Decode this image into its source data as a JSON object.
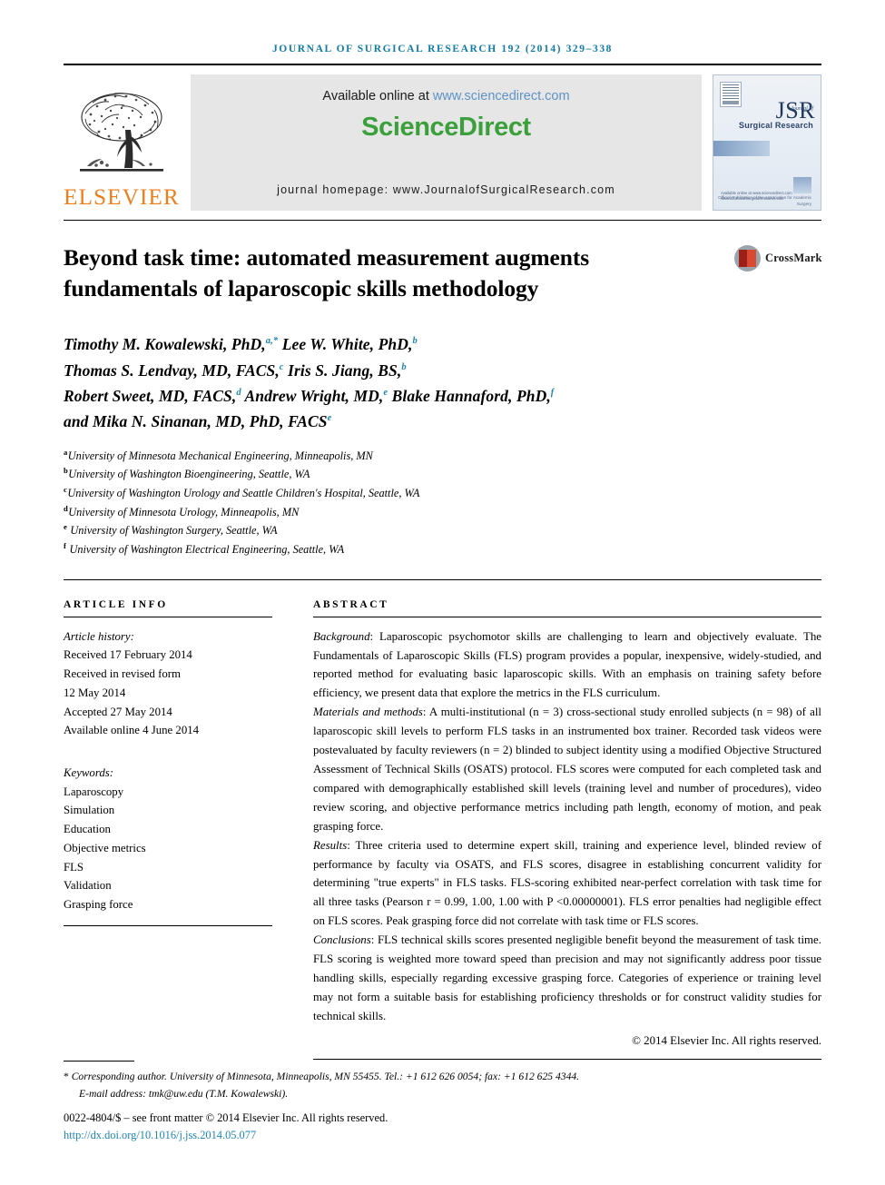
{
  "running_head": "Journal of Surgical Research 192 (2014) 329–338",
  "masthead": {
    "publisher_name": "ELSEVIER",
    "available_prefix": "Available online at",
    "sciencedirect_url": "www.sciencedirect.com",
    "sciencedirect_logo": "ScienceDirect",
    "journal_homepage": "journal homepage: www.JournalofSurgicalResearch.com",
    "cover": {
      "acronym": "JSR",
      "sub_italic": "Journal of",
      "subtitle": "Surgical Research",
      "association_line": "Official Publication of the\nAssociation for Academic Surgery",
      "foot_line": "Available online at www.sciencedirect.com\nwww.JournalofSurgicalResearch.com"
    }
  },
  "title": "Beyond task time: automated measurement augments fundamentals of laparoscopic skills methodology",
  "crossmark_label": "CrossMark",
  "authors_html": "Timothy M. Kowalewski, PhD,<sup>a,*</sup> Lee W. White, PhD,<sup>b</sup><br>Thomas S. Lendvay, MD, FACS,<sup>c</sup> Iris S. Jiang, BS,<sup>b</sup><br>Robert Sweet, MD, FACS,<sup>d</sup> Andrew Wright, MD,<sup>e</sup> Blake Hannaford, PhD,<sup>f</sup><br>and Mika N. Sinanan, MD, PhD, FACS<sup>e</sup>",
  "affiliations_html": "<sup>a</sup>University of Minnesota Mechanical Engineering, Minneapolis, MN<br><sup>b</sup>University of Washington Bioengineering, Seattle, WA<br><sup>c</sup>University of Washington Urology and Seattle Children's Hospital, Seattle, WA<br><sup>d</sup>University of Minnesota Urology, Minneapolis, MN<br><sup>e</sup> University of Washington Surgery, Seattle, WA<br><sup>f</sup> University of Washington Electrical Engineering, Seattle, WA",
  "article_info": {
    "heading": "ARTICLE INFO",
    "history_label": "Article history:",
    "history": [
      "Received 17 February 2014",
      "Received in revised form",
      "12 May 2014",
      "Accepted 27 May 2014",
      "Available online 4 June 2014"
    ],
    "keywords_label": "Keywords:",
    "keywords": [
      "Laparoscopy",
      "Simulation",
      "Education",
      "Objective metrics",
      "FLS",
      "Validation",
      "Grasping force"
    ]
  },
  "abstract": {
    "heading": "ABSTRACT",
    "background_label": "Background",
    "background_text": ": Laparoscopic psychomotor skills are challenging to learn and objectively evaluate. The Fundamentals of Laparoscopic Skills (FLS) program provides a popular, inexpensive, widely-studied, and reported method for evaluating basic laparoscopic skills. With an emphasis on training safety before efficiency, we present data that explore the metrics in the FLS curriculum.",
    "methods_label": "Materials and methods",
    "methods_text": ": A multi-institutional (n = 3) cross-sectional study enrolled subjects (n = 98) of all laparoscopic skill levels to perform FLS tasks in an instrumented box trainer. Recorded task videos were postevaluated by faculty reviewers (n = 2) blinded to subject identity using a modified Objective Structured Assessment of Technical Skills (OSATS) protocol. FLS scores were computed for each completed task and compared with demographically established skill levels (training level and number of procedures), video review scoring, and objective performance metrics including path length, economy of motion, and peak grasping force.",
    "results_label": "Results",
    "results_text": ": Three criteria used to determine expert skill, training and experience level, blinded review of performance by faculty via OSATS, and FLS scores, disagree in establishing concurrent validity for determining \"true experts\" in FLS tasks. FLS-scoring exhibited near-perfect correlation with task time for all three tasks (Pearson r = 0.99, 1.00, 1.00 with P <0.00000001). FLS error penalties had negligible effect on FLS scores. Peak grasping force did not correlate with task time or FLS scores.",
    "conclusions_label": "Conclusions",
    "conclusions_text": ": FLS technical skills scores presented negligible benefit beyond the measurement of task time. FLS scoring is weighted more toward speed than precision and may not significantly address poor tissue handling skills, especially regarding excessive grasping force. Categories of experience or training level may not form a suitable basis for establishing proficiency thresholds or for construct validity studies for technical skills.",
    "copyright": "© 2014 Elsevier Inc. All rights reserved."
  },
  "footnotes": {
    "corresponding_star": "*",
    "corresponding_label": "Corresponding author.",
    "corresponding_address": " University of Minnesota, Minneapolis, MN 55455. Tel.: +1 612 626 0054; fax: +1 612 625 4344.",
    "email_label": "E-mail address:",
    "email": "tmk@uw.edu",
    "email_owner": "(T.M. Kowalewski).",
    "issn_line": "0022-4804/$ – see front matter © 2014 Elsevier Inc. All rights reserved.",
    "doi": "http://dx.doi.org/10.1016/j.jss.2014.05.077"
  },
  "colors": {
    "journal_header": "#0f7ba8",
    "elsevier_orange": "#ef7d1a",
    "sciencedirect_green": "#3ba03b",
    "link_blue": "#1f86b4",
    "banner_gray": "#e6e6e6"
  }
}
